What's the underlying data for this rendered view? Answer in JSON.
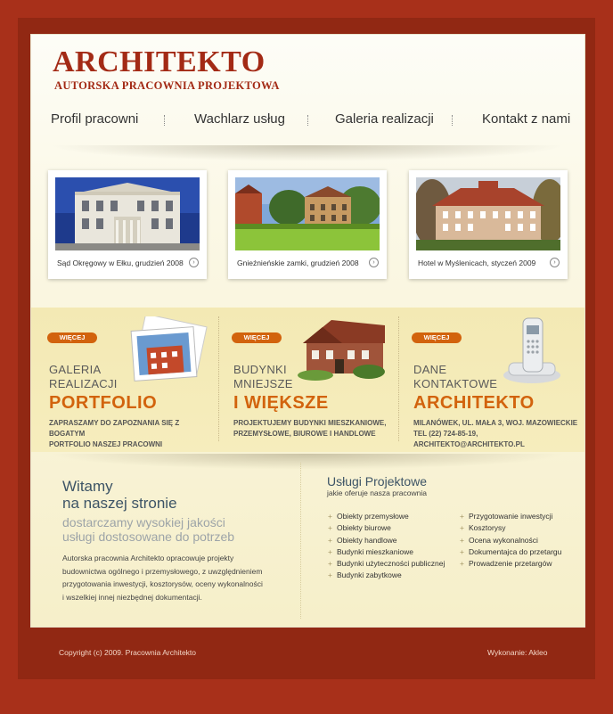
{
  "header": {
    "logo_title": "ARCHITEKTO",
    "logo_subtitle": "AUTORSKA PRACOWNIA PROJEKTOWA"
  },
  "nav": {
    "items": [
      "Profil pracowni",
      "Wachlarz usług",
      "Galeria realizacji",
      "Kontakt z nami"
    ]
  },
  "gallery": {
    "items": [
      {
        "caption": "Sąd Okręgowy w Ełku, grudzień 2008",
        "icon": "arrow-right-icon"
      },
      {
        "caption": "Gnieźnieńskie zamki, grudzień 2008",
        "icon": "arrow-right-icon"
      },
      {
        "caption": "Hotel w Myślenicach, styczeń 2009",
        "icon": "arrow-right-icon"
      }
    ]
  },
  "features": {
    "items": [
      {
        "more": "WIĘCEJ",
        "line1": "GALERIA",
        "line2": "REALIZACJI",
        "big": "PORTFOLIO",
        "desc1": "ZAPRASZAMY DO ZAPOZNANIA SIĘ Z BOGATYM",
        "desc2": "PORTFOLIO NASZEJ PRACOWNI"
      },
      {
        "more": "WIĘCEJ",
        "line1": "BUDYNKI",
        "line2": "MNIEJSZE",
        "big": "I WIĘKSZE",
        "desc1": "PROJEKTUJEMY BUDYNKI MIESZKANIOWE,",
        "desc2": "PRZEMYSŁOWE, BIUROWE I HANDLOWE"
      },
      {
        "more": "WIĘCEJ",
        "line1": "DANE",
        "line2": "KONTAKTOWE",
        "big": "ARCHITEKTO",
        "desc1": "MILANÓWEK, UL. MAŁA 3, WOJ. MAZOWIECKIE",
        "desc2": "TEL (22) 724-85-19, ARCHITEKTO@ARCHITEKTO.PL"
      }
    ]
  },
  "welcome": {
    "line1": "Witamy",
    "line2": "na naszej stronie",
    "tagline1": "dostarczamy wysokiej jakości",
    "tagline2": "usługi dostosowane do potrzeb",
    "text1": "Autorska pracownia Architekto opracowuje projekty",
    "text2": "budownictwa ogólnego i przemysłowego, z uwzględnieniem",
    "text3": "przygotowania inwestycji, kosztorysów, oceny wykonalności",
    "text4": "i wszelkiej innej niezbędnej dokumentacji."
  },
  "services": {
    "title": "Usługi Projektowe",
    "subtitle": "jakie oferuje nasza pracownia",
    "col1": [
      "Obiekty przemysłowe",
      "Obiekty biurowe",
      "Obiekty handlowe",
      "Budynki mieszkaniowe",
      "Budynki użyteczności publicznej",
      "Budynki zabytkowe"
    ],
    "col2": [
      "Przygotowanie inwestycji",
      "Kosztorysy",
      "Ocena wykonalności",
      "Dokumentajca do przetargu",
      "Prowadzenie przetargów"
    ]
  },
  "footer": {
    "copyright": "Copyright (c) 2009. Pracownia Architekto",
    "credit": "Wykonanie: Akleo"
  },
  "colors": {
    "background": "#a8301a",
    "accent": "#d2630d",
    "logo": "#a32a15",
    "heading": "#3d5466"
  }
}
